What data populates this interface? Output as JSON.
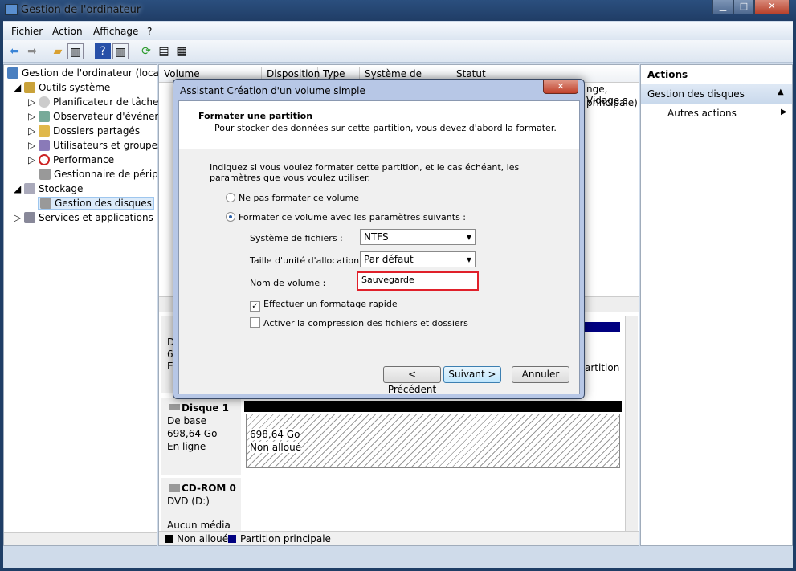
{
  "window": {
    "title": "Gestion de l'ordinateur",
    "min": "▁",
    "max": "□",
    "close": "✕"
  },
  "menu": [
    "Fichier",
    "Action",
    "Affichage",
    "?"
  ],
  "tree": {
    "root": "Gestion de l'ordinateur (local)",
    "tools": "Outils système",
    "items": [
      "Planificateur de tâches",
      "Observateur d'événeme",
      "Dossiers partagés",
      "Utilisateurs et groupes l",
      "Performance",
      "Gestionnaire de périphé"
    ],
    "storage": "Stockage",
    "disks": "Gestion des disques",
    "services": "Services et applications"
  },
  "volume_list": {
    "columns": [
      "Volume",
      "Disposition",
      "Type",
      "Système de fichiers",
      "Statut"
    ],
    "row1_tail": "nge, Vidage s",
    "row2_tail": "principale)"
  },
  "disks": [
    {
      "name": "D",
      "cap": "69",
      "state": "E",
      "partition_tail": "artition"
    },
    {
      "name": "Disque 1",
      "type": "De base",
      "size": "698,64 Go",
      "state": "En ligne",
      "region_size": "698,64 Go",
      "region_label": "Non alloué"
    },
    {
      "name": "CD-ROM 0",
      "type": "DVD (D:)",
      "state": "Aucun média"
    }
  ],
  "legend": [
    {
      "label": "Non alloué",
      "color": "#000000"
    },
    {
      "label": "Partition principale",
      "color": "#000080"
    }
  ],
  "actions": {
    "title": "Actions",
    "section": "Gestion des disques",
    "more": "Autres actions"
  },
  "dialog": {
    "title": "Assistant Création d'un volume simple",
    "heading": "Formater une partition",
    "subheading": "Pour stocker des données sur cette partition, vous devez d'abord la formater.",
    "intro": "Indiquez si vous voulez formater cette partition, et le cas échéant, les paramètres que vous voulez utiliser.",
    "radio_no": "Ne pas formater ce volume",
    "radio_yes": "Formater ce volume avec les paramètres suivants :",
    "fs_label": "Système de fichiers :",
    "fs_value": "NTFS",
    "alloc_label": "Taille d'unité d'allocation :",
    "alloc_value": "Par défaut",
    "name_label": "Nom de volume :",
    "name_value": "Sauvegarde",
    "quick": "Effectuer un formatage rapide",
    "quick_checked": true,
    "compress": "Activer la compression des fichiers et dossiers",
    "compress_checked": false,
    "back": "< Précédent",
    "next": "Suivant >",
    "cancel": "Annuler",
    "highlight_color": "#e0202a"
  }
}
